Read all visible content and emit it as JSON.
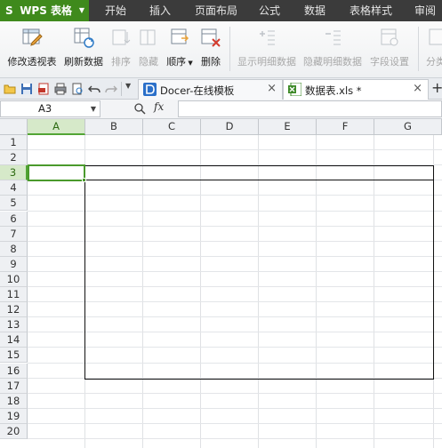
{
  "app": {
    "button_label": "WPS 表格",
    "logo_letter": "S"
  },
  "menu_tabs": [
    "开始",
    "插入",
    "页面布局",
    "公式",
    "数据",
    "表格样式",
    "审阅"
  ],
  "ribbon": {
    "buttons": [
      {
        "label": "修改透视表",
        "enabled": true,
        "icon": "edit-pivot-icon"
      },
      {
        "label": "刷新数据",
        "enabled": true,
        "icon": "refresh-data-icon"
      },
      {
        "label": "排序",
        "enabled": false,
        "icon": "sort-icon"
      },
      {
        "label": "隐藏",
        "enabled": false,
        "icon": "hide-icon"
      },
      {
        "label": "顺序",
        "enabled": true,
        "icon": "order-icon",
        "has_dropdown": true
      },
      {
        "label": "删除",
        "enabled": true,
        "icon": "delete-icon"
      },
      {
        "label": "显示明细数据",
        "enabled": false,
        "icon": "show-detail-icon"
      },
      {
        "label": "隐藏明细数据",
        "enabled": false,
        "icon": "hide-detail-icon"
      },
      {
        "label": "字段设置",
        "enabled": false,
        "icon": "field-settings-icon"
      },
      {
        "label": "分类",
        "enabled": false,
        "icon": "category-icon"
      }
    ]
  },
  "doc_tabs": [
    {
      "title": "Docer-在线模板",
      "close": "×",
      "active": false
    },
    {
      "title": "数据表.xls *",
      "close": "×",
      "active": true
    }
  ],
  "new_tab": "+",
  "formula_bar": {
    "name_box": "A3",
    "fx_label": "fx",
    "formula": ""
  },
  "grid": {
    "columns": [
      "A",
      "B",
      "C",
      "D",
      "E",
      "F",
      "G"
    ],
    "rows": [
      "1",
      "2",
      "3",
      "4",
      "5",
      "6",
      "7",
      "8",
      "9",
      "10",
      "11",
      "12",
      "13",
      "14",
      "15",
      "16",
      "17",
      "18",
      "19",
      "20"
    ],
    "selected_cell": "A3",
    "selected_column": "A",
    "selected_row": "3"
  },
  "colors": {
    "wps_green": "#3f8a1c",
    "selection_green": "#4a9a2c",
    "topbar": "#3b3b3b"
  }
}
